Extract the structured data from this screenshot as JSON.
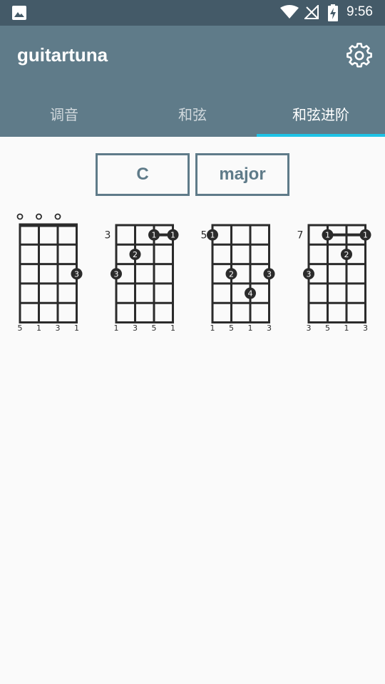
{
  "status_bar": {
    "time": "9:56"
  },
  "app": {
    "title": "guitartuna"
  },
  "tabs": [
    {
      "label": "调音",
      "active": false
    },
    {
      "label": "和弦",
      "active": false
    },
    {
      "label": "和弦进阶",
      "active": true
    }
  ],
  "selectors": {
    "key": "C",
    "quality": "major"
  },
  "colors": {
    "status_bar": "#445a68",
    "app_bar": "#5f7b89",
    "tab_indicator": "#1ec3e6",
    "fretboard": "#2b2b2b"
  },
  "chords": [
    {
      "start_fret_label": "",
      "open_strings": [
        0,
        1,
        2
      ],
      "nut": true,
      "barre": null,
      "dots": [
        {
          "string": 3,
          "fret": 3,
          "finger": "3"
        }
      ],
      "intervals": [
        "5",
        "1",
        "3",
        "1"
      ]
    },
    {
      "start_fret_label": "3",
      "open_strings": [],
      "nut": false,
      "barre": {
        "fret": 1,
        "from": 2,
        "to": 3,
        "finger": "1"
      },
      "dots": [
        {
          "string": 1,
          "fret": 2,
          "finger": "2"
        },
        {
          "string": 0,
          "fret": 3,
          "finger": "3"
        }
      ],
      "intervals": [
        "1",
        "3",
        "5",
        "1"
      ]
    },
    {
      "start_fret_label": "5",
      "open_strings": [],
      "nut": false,
      "barre": null,
      "dots": [
        {
          "string": 0,
          "fret": 1,
          "finger": "1"
        },
        {
          "string": 1,
          "fret": 3,
          "finger": "2"
        },
        {
          "string": 3,
          "fret": 3,
          "finger": "3"
        },
        {
          "string": 2,
          "fret": 4,
          "finger": "4"
        }
      ],
      "intervals": [
        "1",
        "5",
        "1",
        "3"
      ]
    },
    {
      "start_fret_label": "7",
      "open_strings": [],
      "nut": false,
      "barre": {
        "fret": 1,
        "from": 1,
        "to": 3,
        "finger": "1"
      },
      "dots": [
        {
          "string": 2,
          "fret": 2,
          "finger": "2"
        },
        {
          "string": 0,
          "fret": 3,
          "finger": "3"
        }
      ],
      "intervals": [
        "3",
        "5",
        "1",
        "3"
      ]
    }
  ]
}
